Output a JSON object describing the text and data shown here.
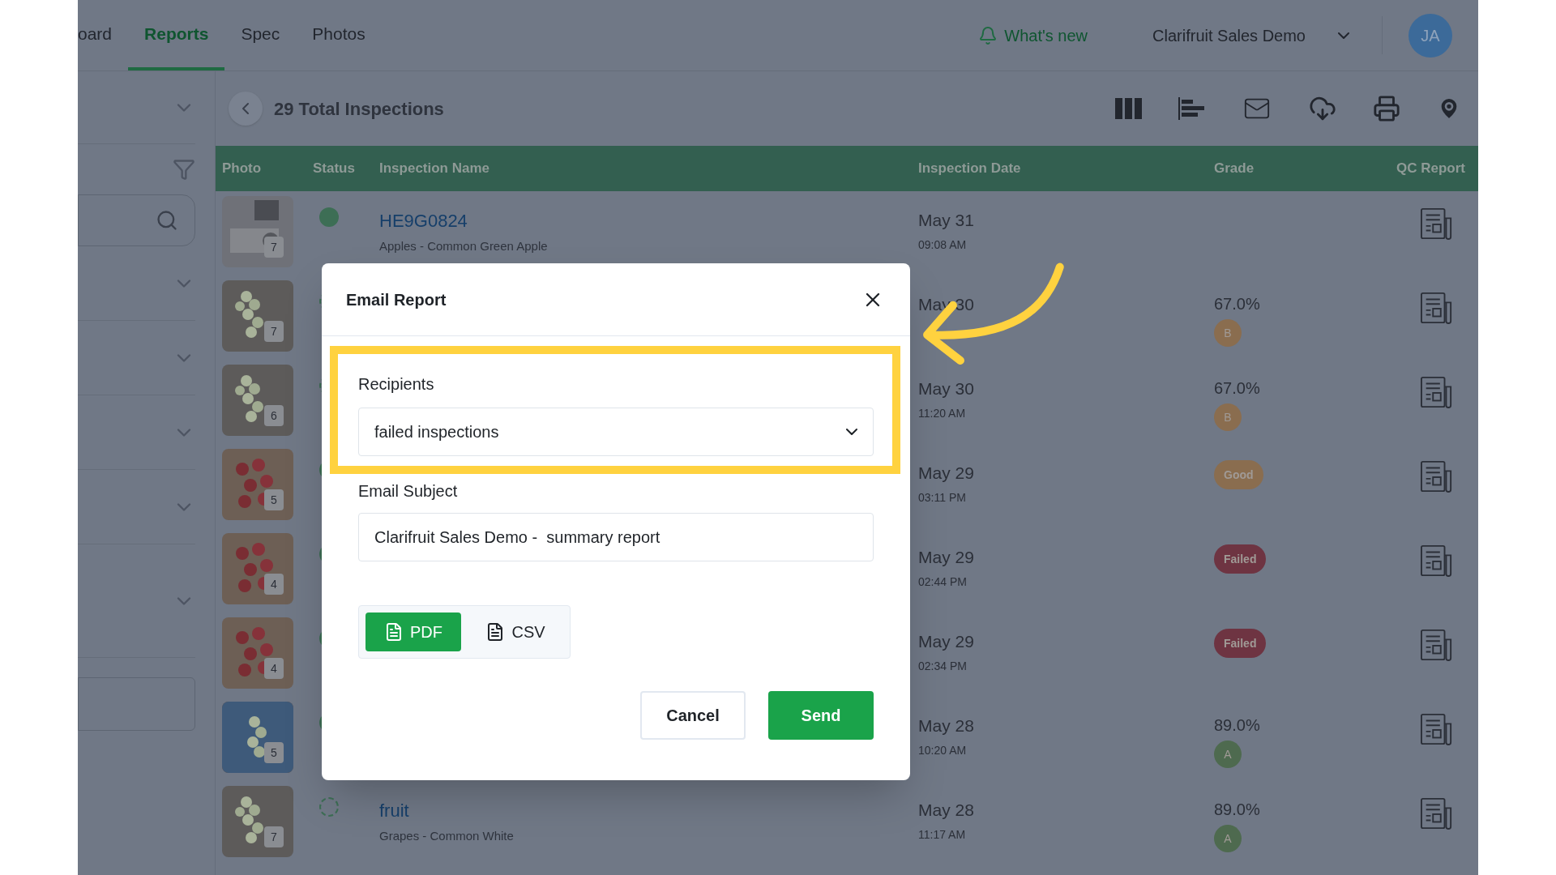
{
  "nav": {
    "tabs": [
      {
        "label": "oard",
        "selected": false
      },
      {
        "label": "Reports",
        "selected": true
      },
      {
        "label": "Spec",
        "selected": false
      },
      {
        "label": "Photos",
        "selected": false
      }
    ],
    "whats_new": "What's new",
    "account": "Clarifruit Sales Demo",
    "avatar": "JA"
  },
  "toolbar": {
    "title": "29 Total Inspections"
  },
  "table": {
    "columns": [
      "Photo",
      "Status",
      "Inspection Name",
      "Inspection Date",
      "Grade",
      "QC Report"
    ],
    "rows": [
      {
        "photo_count": "7",
        "completed": true,
        "name": "HE9G0824",
        "product": "Apples - Common Green Apple",
        "date": "May 31",
        "time": "09:08 AM"
      },
      {
        "photo_count": "7",
        "completed": false,
        "date": "May 30",
        "score": "67.0%",
        "grade": {
          "label": "B",
          "kind": "circle",
          "color": "#8a6d4f"
        }
      },
      {
        "photo_count": "6",
        "completed": false,
        "date": "May 30",
        "time": "11:20 AM",
        "score": "67.0%",
        "grade": {
          "label": "B",
          "kind": "circle",
          "color": "#8a6d4f"
        }
      },
      {
        "photo_count": "5",
        "completed": true,
        "date": "May 29",
        "time": "03:11 PM",
        "grade": {
          "label": "Good",
          "kind": "pill",
          "color": "#8a6d4f"
        }
      },
      {
        "photo_count": "4",
        "completed": true,
        "date": "May 29",
        "time": "02:44 PM",
        "grade": {
          "label": "Failed",
          "kind": "pill",
          "color": "#6e3442"
        }
      },
      {
        "photo_count": "4",
        "completed": true,
        "date": "May 29",
        "time": "02:34 PM",
        "grade": {
          "label": "Failed",
          "kind": "pill",
          "color": "#6e3442"
        }
      },
      {
        "photo_count": "5",
        "completed": true,
        "date": "May 28",
        "time": "10:20 AM",
        "score": "89.0%",
        "grade": {
          "label": "A",
          "kind": "circle",
          "color": "#4e6a4f"
        }
      },
      {
        "photo_count": "7",
        "completed": false,
        "name": "fruit",
        "product": "Grapes - Common White",
        "date": "May 28",
        "time": "11:17 AM",
        "score": "89.0%",
        "grade": {
          "label": "A",
          "kind": "circle",
          "color": "#4e6a4f"
        }
      }
    ]
  },
  "dialog": {
    "title": "Email Report",
    "recipients": {
      "label": "Recipients",
      "value": "failed inspections"
    },
    "subject": {
      "label": "Email Subject",
      "value": "Clarifruit Sales Demo -  summary report"
    },
    "formats": [
      {
        "label": "PDF",
        "selected": true
      },
      {
        "label": "CSV",
        "selected": false
      }
    ],
    "buttons": [
      {
        "label": "Cancel",
        "kind": "secondary"
      },
      {
        "label": "Send",
        "kind": "primary"
      }
    ]
  }
}
